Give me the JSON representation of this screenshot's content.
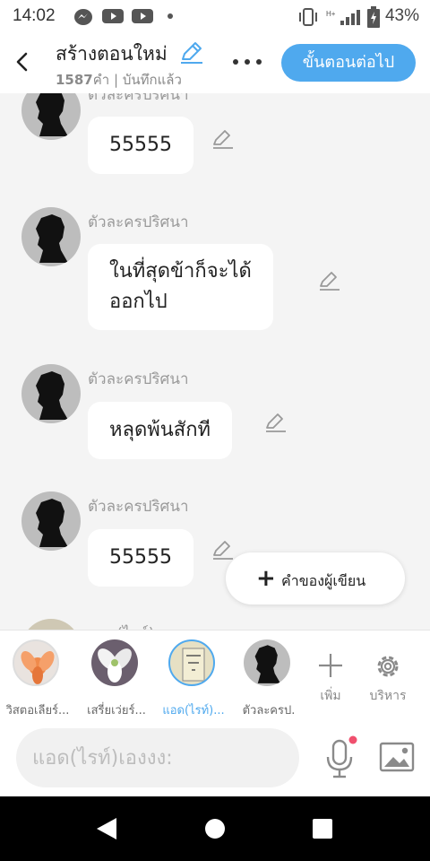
{
  "status_bar": {
    "time": "14:02",
    "battery_text": "43%",
    "left_icons": [
      "messenger-icon",
      "youtube-icon",
      "youtube-icon",
      "dot-icon"
    ],
    "right_icons": [
      "vibrate-icon",
      "signal-icon",
      "battery-icon"
    ]
  },
  "header": {
    "title": "สร้างตอนใหม่",
    "word_count": "1587",
    "word_unit": "คำ",
    "separator": "|",
    "saved_label": "บันทึกแล้ว",
    "next_button": "ขั้นตอนต่อไป"
  },
  "chat": {
    "messages": [
      {
        "name": "ตัวละครปริศนา",
        "text": "55555"
      },
      {
        "name": "ตัวละครปริศนา",
        "text_line1": "ในที่สุดข้าก็จะได้",
        "text_line2": "ออกไป"
      },
      {
        "name": "ตัวละครปริศนา",
        "text": "หลุดพ้นสักที"
      },
      {
        "name": "ตัวละครปริศนา",
        "text": "55555"
      },
      {
        "name": "แอด(ไรท์)เองงง"
      }
    ],
    "fab_label": "คำของผู้เขียน"
  },
  "characters": [
    {
      "label": "วิสตอเลียร์...",
      "icon": "orange-flower-avatar"
    },
    {
      "label": "เสรี่ยเว่ยร์...",
      "icon": "white-flower-avatar"
    },
    {
      "label": "แอด(ไรท์)...",
      "icon": "note-avatar",
      "selected": true
    },
    {
      "label": "ตัวละครป.",
      "icon": "silhouette-avatar"
    }
  ],
  "tools": {
    "add_label": "เพิ่ม",
    "manage_label": "บริหาร"
  },
  "input": {
    "placeholder": "แอด(ไรท์)เองงง:"
  },
  "colors": {
    "accent": "#4fa9ee",
    "selected_label": "#4fa9ee",
    "mic_dot": "#f0506e",
    "chat_bg": "#f4f4f4"
  }
}
